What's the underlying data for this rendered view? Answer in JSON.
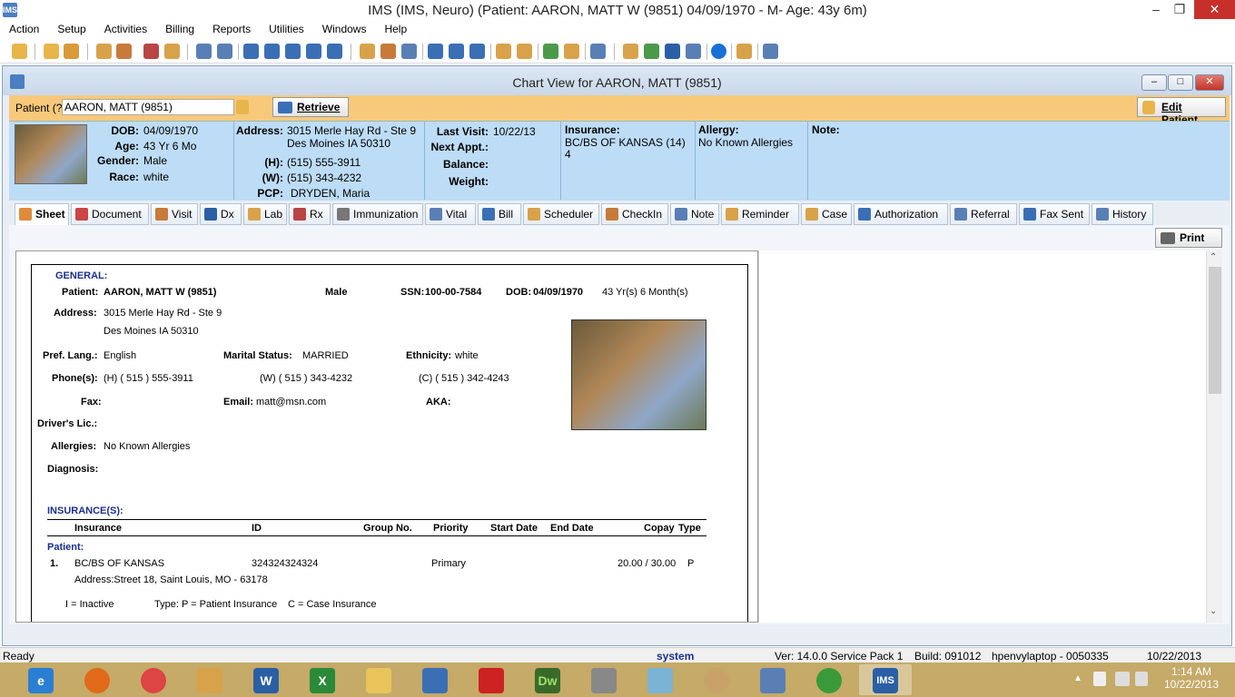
{
  "window": {
    "title": "IMS (IMS, Neuro)     (Patient: AARON, MATT W (9851) 04/09/1970 - M- Age: 43y 6m)",
    "app_icon": "IMS"
  },
  "menu": [
    "Action",
    "Setup",
    "Activities",
    "Billing",
    "Reports",
    "Utilities",
    "Windows",
    "Help"
  ],
  "chart_window": {
    "title": "Chart View for AARON, MATT  (9851)"
  },
  "patient_bar": {
    "label": "Patient (?)",
    "value": "AARON, MATT  (9851)",
    "retrieve": "Retrieve",
    "edit": "Edit Patient"
  },
  "info": {
    "dob_label": "DOB:",
    "dob": "04/09/1970",
    "age_label": "Age:",
    "age": "43 Yr 6 Mo",
    "gender_label": "Gender:",
    "gender": "Male",
    "race_label": "Race:",
    "race": "white",
    "address_label": "Address:",
    "address1": "3015 Merle Hay Rd - Ste 9",
    "address2": "Des Moines  IA  50310",
    "h_label": "(H):",
    "h": "(515) 555-3911",
    "w_label": "(W):",
    "w": "(515) 343-4232",
    "pcp_label": "PCP:",
    "pcp": "DRYDEN, Maria",
    "lastvisit_label": "Last Visit:",
    "lastvisit": "10/22/13",
    "nextappt_label": "Next Appt.:",
    "balance_label": "Balance:",
    "weight_label": "Weight:",
    "insurance_label": "Insurance:",
    "insurance1": "BC/BS OF KANSAS   (14)",
    "insurance2": "4",
    "allergy_label": "Allergy:",
    "allergy": "No Known Allergies",
    "note_label": "Note:"
  },
  "tabs": [
    "Sheet",
    "Document",
    "Visit",
    "Dx",
    "Lab",
    "Rx",
    "Immunization",
    "Vital",
    "Bill",
    "Scheduler",
    "CheckIn",
    "Note",
    "Reminder",
    "Case",
    "Authorization",
    "Referral",
    "Fax Sent",
    "History"
  ],
  "print_label": "Print",
  "sheet": {
    "general": "GENERAL:",
    "patient_label": "Patient:",
    "patient": "AARON, MATT W  (9851)",
    "sex": "Male",
    "ssn_label": "SSN:",
    "ssn": "100-00-7584",
    "dob_label": "DOB:",
    "dob": "04/09/1970",
    "age": "43 Yr(s) 6 Month(s)",
    "address_label": "Address:",
    "address1": "3015 Merle Hay Rd - Ste 9",
    "address2": "Des Moines  IA  50310",
    "lang_label": "Pref. Lang.:",
    "lang": "English",
    "marital_label": "Marital Status:",
    "marital": "MARRIED",
    "ethnicity_label": "Ethnicity:",
    "ethnicity": "white",
    "phones_label": "Phone(s):",
    "phone_h": "(H)  ( 515 ) 555-3911",
    "phone_w": "(W)  ( 515 ) 343-4232",
    "phone_c": "(C)  ( 515 ) 342-4243",
    "fax_label": "Fax:",
    "email_label": "Email:",
    "email": "matt@msn.com",
    "aka_label": "AKA:",
    "dl_label": "Driver's Lic.:",
    "allergies_label": "Allergies:",
    "allergies": "No Known Allergies",
    "diagnosis_label": "Diagnosis:",
    "insurances": "INSURANCE(S):",
    "ins_headers": [
      "Insurance",
      "ID",
      "Group No.",
      "Priority",
      "Start Date",
      "End Date",
      "Copay",
      "Type"
    ],
    "patient_section": "Patient:",
    "ins_row": {
      "num": "1.",
      "name": "BC/BS OF KANSAS",
      "id": "324324324324",
      "priority": "Primary",
      "copay": "20.00 / 30.00",
      "type": "P"
    },
    "ins_address": "Address:Street 18,  Saint Louis,  MO  -  63178",
    "legend_i": "I = Inactive",
    "legend_type": "Type: P = Patient Insurance",
    "legend_c": "C = Case Insurance"
  },
  "status": {
    "ready": "Ready",
    "user": "system",
    "version": "Ver: 14.0.0 Service Pack 1",
    "build": "Build: 091012",
    "host": "hpenvylaptop - 0050335",
    "date": "10/22/2013"
  },
  "taskbar": {
    "time": "1:14 AM",
    "date": "10/22/2013",
    "dw": "Dw",
    "ims": "IMS"
  },
  "colors": {
    "accent_orange": "#f8c97a",
    "info_blue": "#bddcf6",
    "section_blue": "#1a2f8a",
    "close_red": "#c7302a"
  }
}
